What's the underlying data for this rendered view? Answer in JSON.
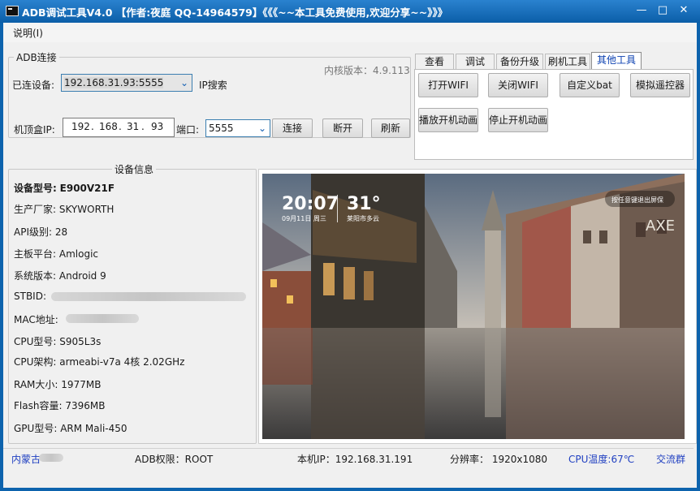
{
  "window": {
    "title": "ADB调试工具V4.0 【作者:夜庭 QQ-14964579】《《《~~本工具免费使用,欢迎分享~~》》》",
    "min": "—",
    "max": "□",
    "close": "✕"
  },
  "menu": {
    "help": "说明(I)"
  },
  "adb": {
    "legend": "ADB连接",
    "kernel_version": "内核版本：4.9.113",
    "connected_label": "已连设备:",
    "connected_value": "192.168.31.93:5555",
    "ip_search": "IP搜索",
    "box_ip_label": "机顶盒IP:",
    "ip": [
      "192",
      "168",
      "31",
      "93"
    ],
    "port_label": "端口:",
    "port_value": "5555",
    "connect": "连接",
    "disconnect": "断开",
    "refresh": "刷新"
  },
  "tabs": [
    "查看",
    "调试",
    "备份升级",
    "刷机工具",
    "其他工具"
  ],
  "active_tab": "其他工具",
  "tools": {
    "open_wifi": "打开WIFI",
    "close_wifi": "关闭WIFI",
    "custom_bat": "自定义bat",
    "remote": "模拟遥控器",
    "play_boot": "播放开机动画",
    "stop_boot": "停止开机动画"
  },
  "device_info": {
    "legend": "设备信息",
    "model_label": "设备型号:",
    "model": "E900V21F",
    "maker_label": "生产厂家:",
    "maker": "SKYWORTH",
    "api_label": "API级别:",
    "api": "28",
    "board_label": "主板平台:",
    "board": "Amlogic",
    "os_label": "系统版本:",
    "os": "Android 9",
    "stbid_label": "STBID:",
    "mac_label": "MAC地址:",
    "cpu_label": "CPU型号:",
    "cpu": "S905L3s",
    "arch_label": "CPU架构:",
    "arch": "armeabi-v7a 4核 2.02GHz",
    "ram_label": "RAM大小:",
    "ram": "1977MB",
    "flash_label": "Flash容量:",
    "flash": "7396MB",
    "gpu_label": "GPU型号:",
    "gpu": "ARM Mali-450"
  },
  "screen": {
    "time": "20:07",
    "temp": "31°",
    "date": "09月11日 周三",
    "weather": "莱阳市多云",
    "hint": "按任意键退出屏保",
    "sign": "AXE"
  },
  "status": {
    "region": "内蒙古",
    "adb_perm": "ADB权限：ROOT",
    "local_ip": "本机IP：192.168.31.191",
    "resolution": "分辨率：  1920x1080",
    "cpu_temp": "CPU温度:67℃",
    "group": "交流群"
  }
}
